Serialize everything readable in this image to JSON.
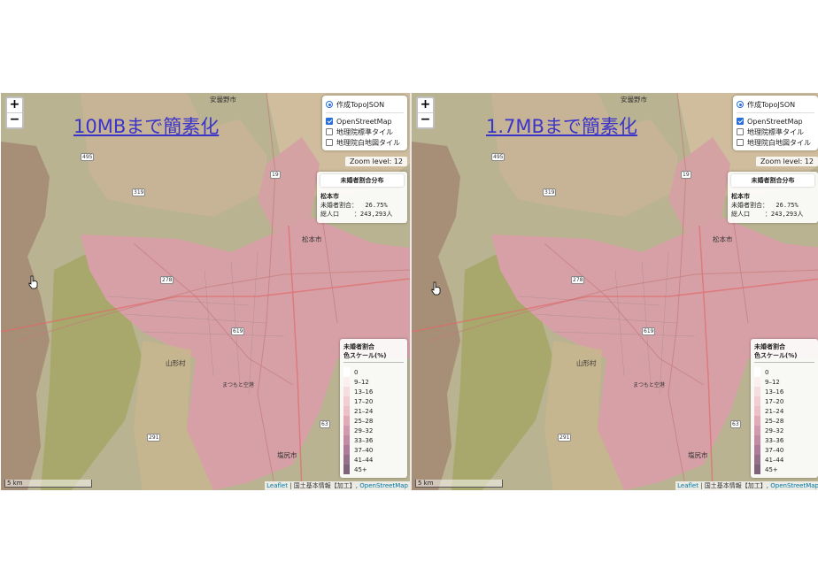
{
  "panels": [
    {
      "overlay_title": "10MBまで簡素化",
      "zoom_in": "+",
      "zoom_out": "−",
      "layers": {
        "base": "作成TopoJSON",
        "overlays": [
          {
            "label": "OpenStreetMap",
            "checked": true
          },
          {
            "label": "地理院標準タイル",
            "checked": false
          },
          {
            "label": "地理院白地図タイル",
            "checked": false
          }
        ]
      },
      "zoom_level": "Zoom level: 12",
      "info": {
        "title": "未婚者割合分布",
        "city": "松本市",
        "ratio_line": "未婚者割合：  26.75%",
        "pop_line": "総人口    ：243,293人"
      },
      "legend": {
        "title1": "未婚者割合",
        "title2": "色スケール(%)",
        "items": [
          "0",
          "9–12",
          "13–16",
          "17–20",
          "21–24",
          "25–28",
          "29–32",
          "33–36",
          "37–40",
          "41–44",
          "45+"
        ]
      },
      "scale": "5 km",
      "attribution": {
        "leaflet": "Leaflet",
        "gsi": " | 国土基本情報【加工】, ",
        "osm": "OpenStreetMap"
      },
      "places": {
        "a": "安曇野市",
        "b": "松本市",
        "c": "山形村",
        "d": "塩尻市",
        "e": "まつもと空港"
      },
      "roads": {
        "r1": "495",
        "r2": "319",
        "r3": "278",
        "r4": "619",
        "r5": "63",
        "r6": "291",
        "r7": "19"
      }
    },
    {
      "overlay_title": "1.7MBまで簡素化",
      "zoom_in": "+",
      "zoom_out": "−",
      "layers": {
        "base": "作成TopoJSON",
        "overlays": [
          {
            "label": "OpenStreetMap",
            "checked": true
          },
          {
            "label": "地理院標準タイル",
            "checked": false
          },
          {
            "label": "地理院白地図タイル",
            "checked": false
          }
        ]
      },
      "zoom_level": "Zoom level: 12",
      "info": {
        "title": "未婚者割合分布",
        "city": "松本市",
        "ratio_line": "未婚者割合：  26.75%",
        "pop_line": "総人口    ：243,293人"
      },
      "legend": {
        "title1": "未婚者割合",
        "title2": "色スケール(%)",
        "items": [
          "0",
          "9–12",
          "13–16",
          "17–20",
          "21–24",
          "25–28",
          "29–32",
          "33–36",
          "37–40",
          "41–44",
          "45+"
        ]
      },
      "scale": "5 km",
      "attribution": {
        "leaflet": "Leaflet",
        "gsi": " | 国土基本情報【加工】, ",
        "osm": "OpenStreetMap"
      },
      "places": {
        "a": "安曇野市",
        "b": "松本市",
        "c": "山形村",
        "d": "塩尻市",
        "e": "まつもと空港"
      },
      "roads": {
        "r1": "495",
        "r2": "319",
        "r3": "278",
        "r4": "619",
        "r5": "63",
        "r6": "291",
        "r7": "19"
      }
    }
  ],
  "colors": {
    "legend_swatches": [
      "#ffffff",
      "#fbeff0",
      "#f6dde0",
      "#f2cdd1",
      "#ecc0c6",
      "#e2aab6",
      "#d399ad",
      "#c28aa3",
      "#ad7c98",
      "#957089",
      "#7f6479"
    ],
    "choropleth": "#d7a0a6",
    "choropleth_dark": "#c48a93",
    "outside": "#a58c76",
    "forest_green": "#a8ad6e",
    "title_blue": "#3b34c9"
  }
}
